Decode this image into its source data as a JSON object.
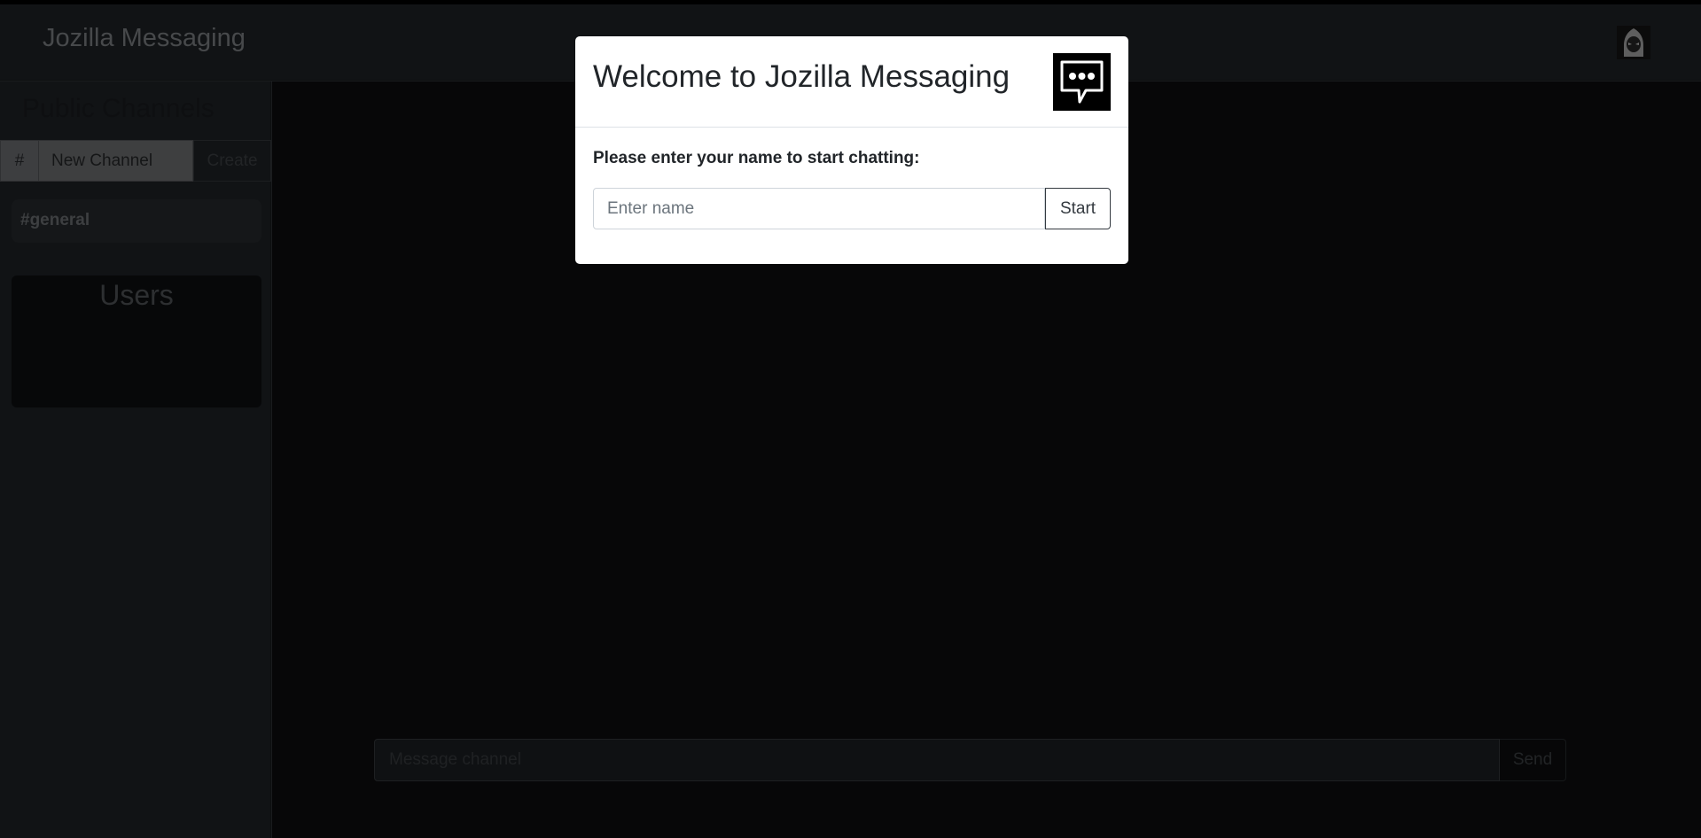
{
  "navbar": {
    "brand": "Jozilla Messaging",
    "avatar_icon": "hooded-user-icon"
  },
  "sidebar": {
    "title": "Public Channels",
    "new_channel": {
      "prefix": "#",
      "value": "New Channel",
      "create_label": "Create"
    },
    "channels": [
      {
        "label": "#general"
      }
    ],
    "users_title": "Users"
  },
  "composer": {
    "placeholder": "Message channel",
    "send_label": "Send"
  },
  "modal": {
    "title": "Welcome to Jozilla Messaging",
    "logo_icon": "chat-bubble-icon",
    "prompt": "Please enter your name to start chatting:",
    "name_placeholder": "Enter name",
    "start_label": "Start"
  }
}
